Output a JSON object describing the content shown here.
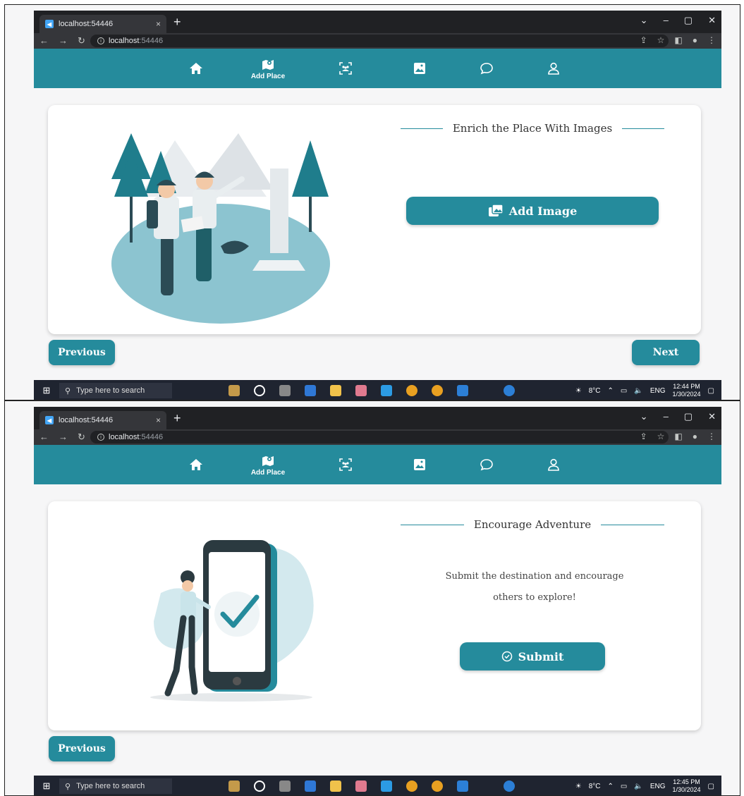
{
  "browser": {
    "tab_title": "localhost:54446",
    "tab_close": "×",
    "new_tab": "+",
    "address_host": "localhost",
    "address_port": ":54446",
    "window_controls": [
      "⌄",
      "–",
      "▢",
      "✕"
    ]
  },
  "navbar": {
    "items": [
      {
        "icon": "home-icon",
        "label": ""
      },
      {
        "icon": "add-place-icon",
        "label": "Add Place"
      },
      {
        "icon": "group-scan-icon",
        "label": ""
      },
      {
        "icon": "gallery-icon",
        "label": ""
      },
      {
        "icon": "chat-icon",
        "label": ""
      },
      {
        "icon": "profile-icon",
        "label": ""
      }
    ],
    "active_color": "#258b9c"
  },
  "step1": {
    "title": "Enrich the Place With Images",
    "add_image_label": "Add Image",
    "previous_label": "Previous",
    "next_label": "Next"
  },
  "step2": {
    "title": "Encourage Adventure",
    "description_line1": "Submit the destination and encourage",
    "description_line2": "others to explore!",
    "submit_label": "Submit",
    "previous_label": "Previous"
  },
  "taskbar": {
    "search_placeholder": "Type here to search",
    "weather": "8°C",
    "language": "ENG",
    "date": "1/30/2024",
    "time_step1": "12:44 PM",
    "time_step2": "12:45 PM"
  },
  "colors": {
    "accent": "#258b9c",
    "page_bg": "#f6f6f7"
  }
}
